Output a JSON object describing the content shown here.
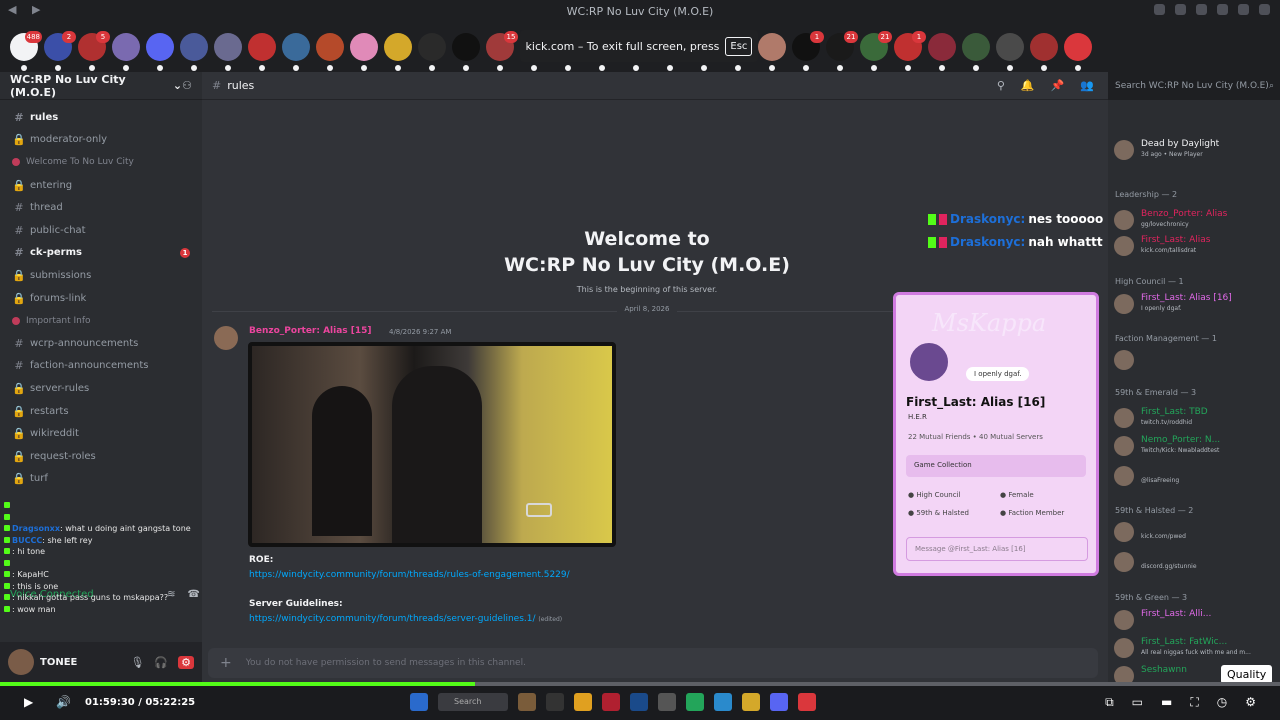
{
  "window": {
    "title": "WC:RP No Luv City (M.O.E)"
  },
  "fullscreen_toast": {
    "text": "kick.com – To exit full screen, press",
    "key": "Esc"
  },
  "servers": [
    {
      "color": "#f2f3f5",
      "badge": "488"
    },
    {
      "color": "#3b4fa8",
      "badge": "2"
    },
    {
      "color": "#b03030",
      "badge": "5"
    },
    {
      "color": "#7a6ab0",
      "badge": ""
    },
    {
      "color": "#5865f2",
      "badge": ""
    },
    {
      "color": "#4a5a9a",
      "badge": ""
    },
    {
      "color": "#6a6a90",
      "badge": ""
    },
    {
      "color": "#c03030",
      "badge": ""
    },
    {
      "color": "#3a6a9a",
      "badge": ""
    },
    {
      "color": "#b54a2a",
      "badge": ""
    },
    {
      "color": "#e08ab8",
      "badge": ""
    },
    {
      "color": "#d4a82a",
      "badge": ""
    },
    {
      "color": "#2a2a2a",
      "badge": ""
    },
    {
      "color": "#111111",
      "badge": ""
    },
    {
      "color": "#a03a3a",
      "badge": "15"
    },
    {
      "color": "#333333",
      "badge": ""
    },
    {
      "color": "#5865f2",
      "badge": ""
    },
    {
      "color": "#5566aa",
      "badge": ""
    },
    {
      "color": "#8a5a4a",
      "badge": ""
    },
    {
      "color": "#6a9a3a",
      "badge": ""
    },
    {
      "color": "#c08a6a",
      "badge": "1"
    },
    {
      "color": "#c0304a",
      "badge": ""
    },
    {
      "color": "#b07a6a",
      "badge": ""
    },
    {
      "color": "#111111",
      "badge": "1"
    },
    {
      "color": "#1a1a1a",
      "badge": "21"
    },
    {
      "color": "#3a6a3a",
      "badge": "21"
    },
    {
      "color": "#c03030",
      "badge": "1"
    },
    {
      "color": "#8a2a3a",
      "badge": ""
    },
    {
      "color": "#3a5a3a",
      "badge": ""
    },
    {
      "color": "#4a4a4a",
      "badge": ""
    },
    {
      "color": "#a03030",
      "badge": ""
    },
    {
      "color": "#da373c",
      "badge": ""
    }
  ],
  "guild": {
    "name": "WC:RP No Luv City (M.O.E)"
  },
  "channels": [
    {
      "kind": "text",
      "name": "rules",
      "state": "active"
    },
    {
      "kind": "locked",
      "name": "moderator-only",
      "state": ""
    },
    {
      "kind": "category",
      "name": "Welcome To No Luv City",
      "state": ""
    },
    {
      "kind": "locked",
      "name": "entering",
      "state": ""
    },
    {
      "kind": "text",
      "name": "thread",
      "state": ""
    },
    {
      "kind": "text",
      "name": "public-chat",
      "state": ""
    },
    {
      "kind": "text",
      "name": "ck-perms",
      "state": "bold",
      "badge": "1"
    },
    {
      "kind": "locked",
      "name": "submissions",
      "state": ""
    },
    {
      "kind": "locked",
      "name": "forums-link",
      "state": ""
    },
    {
      "kind": "category",
      "name": "Important Info",
      "state": ""
    },
    {
      "kind": "text",
      "name": "wcrp-announcements",
      "state": ""
    },
    {
      "kind": "text",
      "name": "faction-announcements",
      "state": ""
    },
    {
      "kind": "locked",
      "name": "server-rules",
      "state": ""
    },
    {
      "kind": "locked",
      "name": "restarts",
      "state": ""
    },
    {
      "kind": "locked",
      "name": "wikireddit",
      "state": ""
    },
    {
      "kind": "locked",
      "name": "request-roles",
      "state": ""
    },
    {
      "kind": "locked",
      "name": "turf",
      "state": ""
    }
  ],
  "overlay_chat": [
    {
      "user": "",
      "user_color": "#e0245e",
      "text": ""
    },
    {
      "user": "",
      "user_color": "#e0245e",
      "text": ""
    },
    {
      "user": "Dragsonxx",
      "user_color": "#1d6fd8",
      "text": ": what u doing aint gangsta tone"
    },
    {
      "user": "BUCCC",
      "user_color": "#1d6fd8",
      "text": ": she left rey"
    },
    {
      "user": "",
      "user_color": "#e0245e",
      "text": ": hi tone"
    },
    {
      "user": "",
      "user_color": "#53fc18",
      "text": ""
    },
    {
      "user": "",
      "user_color": "#e0c040",
      "text": ": KapaHC"
    },
    {
      "user": "",
      "user_color": "#53fc18",
      "text": ": this is one"
    },
    {
      "user": "",
      "user_color": "#1d6fd8",
      "text": ": nikkah gotta pass guns to mskappa??"
    },
    {
      "user": "",
      "user_color": "#e0c040",
      "text": ": wow man"
    }
  ],
  "voice": {
    "status": "Voice Connected"
  },
  "user": {
    "name": "TONEE"
  },
  "main": {
    "channel": "rules",
    "welcome_line1": "Welcome to",
    "welcome_line2": "WC:RP No Luv City (M.O.E)",
    "beginning": "This is the beginning of this server.",
    "date_separator": "April 8, 2026",
    "message": {
      "author": "Benzo_Porter: Alias [15]",
      "time": "4/8/2026 9:27 AM",
      "roe_label": "ROE:",
      "roe_link": "https://windycity.community/forum/threads/rules-of-engagement.5229/",
      "sg_label": "Server Guidelines:",
      "sg_link": "https://windycity.community/forum/threads/server-guidelines.1/",
      "edited": "(edited)"
    },
    "compose_placeholder": "You do not have permission to send messages in this channel."
  },
  "kick_chat": [
    {
      "user": "Draskonyc:",
      "text": "nes tooooo"
    },
    {
      "user": "Draskonyc:",
      "text": "nah whattt"
    }
  ],
  "profile_popup": {
    "brand": "MsKappa",
    "status": "I openly dgaf.",
    "name": "First_Last: Alias [16]",
    "tag": "H.E.R",
    "mutuals": "22 Mutual Friends • 40 Mutual Servers",
    "game_collection": "Game Collection",
    "roles": [
      "High Council",
      "Female",
      "59th & Halsted",
      "Faction Member"
    ],
    "dm_placeholder": "Message @First_Last: Alias [16]"
  },
  "search": {
    "placeholder": "Search WC:RP No Luv City (M.O.E)"
  },
  "member_groups": [
    {
      "label": "Leadership — 2"
    },
    {
      "label": "High Council — 1"
    },
    {
      "label": "Faction Management — 1"
    },
    {
      "label": "59th & Emerald — 3"
    },
    {
      "label": "59th & Halsted — 2"
    },
    {
      "label": "59th & Green — 3"
    }
  ],
  "members": [
    {
      "name": "Dead by Daylight",
      "sub": "3d ago • New Player",
      "color": "#f2f3f5"
    },
    {
      "name": "Benzo_Porter: Alias",
      "sub": "gg/lovechronicy",
      "color": "#e0245e"
    },
    {
      "name": "First_Last: Alias",
      "sub": "kick.com/tallisdrat",
      "color": "#e0245e"
    },
    {
      "name": "First_Last: Alias [16]",
      "sub": "I openly dgaf.",
      "color": "#e06ae8"
    },
    {
      "name": "",
      "sub": "",
      "color": "#f2f3f5"
    },
    {
      "name": "First_Last: TBD",
      "sub": "twitch.tv/roddhid",
      "color": "#23a55a"
    },
    {
      "name": "Nemo_Porter: N...",
      "sub": "Twitch/Kick: Nwabladdtest",
      "color": "#23a55a"
    },
    {
      "name": "",
      "sub": "@lisaFreeing",
      "color": "#23a55a"
    },
    {
      "name": "",
      "sub": "kick.com/pwed",
      "color": "#23a55a"
    },
    {
      "name": "",
      "sub": "discord.gg/stunnie",
      "color": "#e06ae8"
    },
    {
      "name": "First_Last: Alli...",
      "sub": "",
      "color": "#e06ae8"
    },
    {
      "name": "First_Last: FatWic...",
      "sub": "All real niggas fuck with me and m...",
      "color": "#23a55a"
    },
    {
      "name": "Seshawnn",
      "sub": "",
      "color": "#23a55a"
    }
  ],
  "player": {
    "time": "01:59:30 / 05:22:25",
    "progress": 0.371,
    "quality_tooltip": "Quality",
    "taskbar_search": "Search"
  }
}
